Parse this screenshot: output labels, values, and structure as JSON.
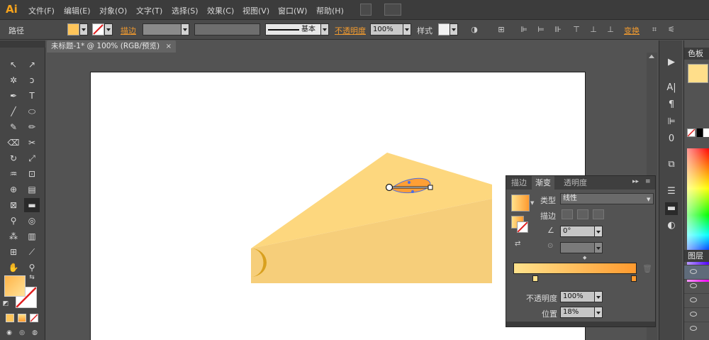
{
  "app": {
    "logo": "Ai"
  },
  "menu": [
    "文件(F)",
    "编辑(E)",
    "对象(O)",
    "文字(T)",
    "选择(S)",
    "效果(C)",
    "视图(V)",
    "窗口(W)",
    "帮助(H)"
  ],
  "control_bar": {
    "selection_label": "路径",
    "stroke_label": "描边",
    "stroke_style": "基本",
    "opacity_label": "不透明度",
    "opacity_value": "100%",
    "style_label": "样式",
    "transform_label": "变换",
    "fill_color": "#ffc55a"
  },
  "document": {
    "tab_title": "未标题-1* @ 100% (RGB/预览)",
    "close_icon": "×"
  },
  "gradient_panel": {
    "tabs": [
      "描边",
      "渐变",
      "透明度"
    ],
    "active_tab": "渐变",
    "type_label": "类型",
    "type_value": "线性",
    "stroke_label": "描边",
    "angle_value": "0°",
    "opacity_label": "不透明度",
    "opacity_value": "100%",
    "location_label": "位置",
    "location_value": "18%",
    "start_color": "#ffe28c",
    "end_color": "#ff9a2e"
  },
  "right_panels": {
    "color_tab": "色板",
    "layers_tab": "图层",
    "swatch_color": "#ffde8a"
  },
  "colors": {
    "cheese_top": "#fdd77e",
    "cheese_side": "#f6ce7a",
    "hole": "#d9a01e",
    "accent": "#f29b2f"
  }
}
